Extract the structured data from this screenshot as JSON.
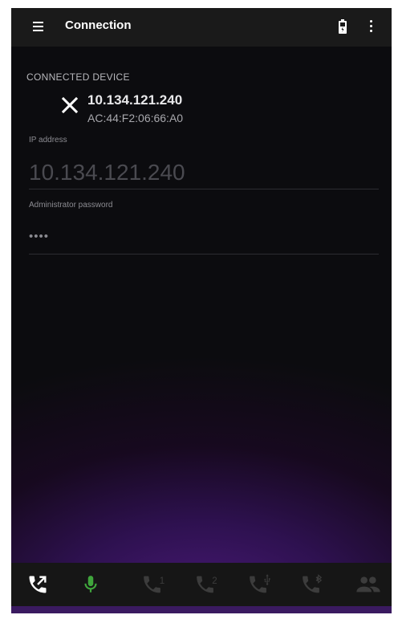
{
  "appbar": {
    "title": "Connection",
    "menu_icon": "menu-icon",
    "battery_icon": "battery-icon",
    "more_icon": "more-vert-icon"
  },
  "connected_device": {
    "section_label": "CONNECTED DEVICE",
    "ip": "10.134.121.240",
    "mac": "AC:44:F2:06:66:A0",
    "disconnect_icon": "close-icon"
  },
  "form": {
    "ip_label": "IP address",
    "ip_value": "10.134.121.240",
    "password_label": "Administrator password",
    "password_value": "••••"
  },
  "bottom_tabs": [
    {
      "name": "call-transfer",
      "icon": "call-transfer-icon",
      "active": true,
      "color": "#ffffff"
    },
    {
      "name": "microphone",
      "icon": "mic-icon",
      "active": true,
      "color": "#3fa53c"
    },
    {
      "name": "line-1",
      "icon": "phone-1-icon",
      "label": "1",
      "active": false
    },
    {
      "name": "line-2",
      "icon": "phone-2-icon",
      "label": "2",
      "active": false
    },
    {
      "name": "usb",
      "icon": "phone-usb-icon",
      "active": false
    },
    {
      "name": "bluetooth",
      "icon": "phone-bluetooth-icon",
      "active": false
    },
    {
      "name": "conference",
      "icon": "people-icon",
      "active": false
    }
  ],
  "colors": {
    "appbar_bg": "#1a1a1a",
    "bottombar_bg": "#161616",
    "active_mic": "#3fa53c",
    "inactive_icon": "#3c3c3c",
    "accent_purple": "#4a1a78"
  }
}
